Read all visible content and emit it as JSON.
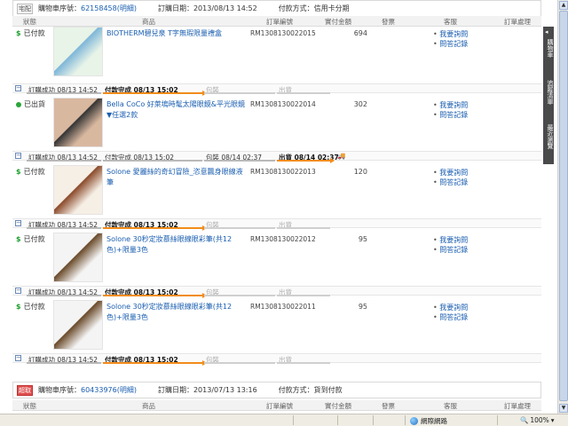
{
  "orders": [
    {
      "tag": "宅配",
      "order_label": "購物車序號：",
      "order_no": "62158458",
      "detail_link": "(明細)",
      "date_label": "訂購日期：2013/08/13 14:52",
      "pay_label": "付款方式：信用卡分期"
    },
    {
      "tag": "超取",
      "order_label": "購物車序號：",
      "order_no": "60433976",
      "detail_link": "(明細)",
      "date_label": "訂購日期：2013/07/13 13:16",
      "pay_label": "付款方式：貨到付款"
    }
  ],
  "columns": [
    "狀態",
    "商品",
    "訂單編號",
    "實付金額",
    "發票",
    "客服",
    "訂單處理"
  ],
  "items": [
    {
      "status": "已付款",
      "status_type": "paid",
      "name": "BIOTHERM碧兒泉 T字無瑕限量禮盒",
      "order_id": "RM1308130022015",
      "amount": "694",
      "svc": [
        "我要詢問",
        "問答記錄"
      ],
      "steps": [
        {
          "label": "訂購成功 08/13 14:52",
          "state": "done"
        },
        {
          "label": "付款完成 08/13 15:02",
          "state": "current"
        },
        {
          "label": "包裝",
          "state": "pending"
        },
        {
          "label": "出貨",
          "state": "pending"
        }
      ]
    },
    {
      "status": "已出貨",
      "status_type": "shipped",
      "name": "Bella CoCo 好萊塢時髦太陽眼鏡&平光眼鏡▼任選2款",
      "order_id": "RM1308130022014",
      "amount": "302",
      "svc": [
        "我要詢問",
        "問答記錄"
      ],
      "steps": [
        {
          "label": "訂購成功 08/13 14:52",
          "state": "done"
        },
        {
          "label": "付款完成 08/13 15:02",
          "state": "done"
        },
        {
          "label": "包裝 08/14 02:37",
          "state": "done"
        },
        {
          "label": "出貨 08/14 02:37",
          "state": "current"
        }
      ]
    },
    {
      "status": "已付款",
      "status_type": "paid",
      "name": "Solone 愛麗絲的奇幻冒險_恣意飄身眼線液筆",
      "order_id": "RM1308130022013",
      "amount": "120",
      "svc": [
        "我要詢問",
        "問答記錄"
      ],
      "steps": [
        {
          "label": "訂購成功 08/13 14:52",
          "state": "done"
        },
        {
          "label": "付款完成 08/13 15:02",
          "state": "current"
        },
        {
          "label": "包裝",
          "state": "pending"
        },
        {
          "label": "出貨",
          "state": "pending"
        }
      ]
    },
    {
      "status": "已付款",
      "status_type": "paid",
      "name": "Solone 30秒定妝慕絲眼線眼彩筆(共12色)+限量3色",
      "order_id": "RM1308130022012",
      "amount": "95",
      "svc": [
        "我要詢問",
        "問答記錄"
      ],
      "steps": [
        {
          "label": "訂購成功 08/13 14:52",
          "state": "done"
        },
        {
          "label": "付款完成 08/13 15:02",
          "state": "current"
        },
        {
          "label": "包裝",
          "state": "pending"
        },
        {
          "label": "出貨",
          "state": "pending"
        }
      ]
    },
    {
      "status": "已付款",
      "status_type": "paid",
      "name": "Solone 30秒定妝慕絲眼線眼彩筆(共12色)+限量3色",
      "order_id": "RM1308130022011",
      "amount": "95",
      "svc": [
        "我要詢問",
        "問答記錄"
      ],
      "steps": [
        {
          "label": "訂購成功 08/13 14:52",
          "state": "done"
        },
        {
          "label": "付款完成 08/13 15:02",
          "state": "current"
        },
        {
          "label": "包裝",
          "state": "pending"
        },
        {
          "label": "出貨",
          "state": "pending"
        }
      ]
    }
  ],
  "side_tabs": [
    "購物車",
    "追蹤清單",
    "最近瀏覽"
  ],
  "statusbar": {
    "zone": "網際網路",
    "zoom": "100%"
  },
  "colors": {
    "link": "#1a5eb0",
    "progress_accent": "#f28c1a",
    "paid_icon": "#1a9e2a"
  }
}
